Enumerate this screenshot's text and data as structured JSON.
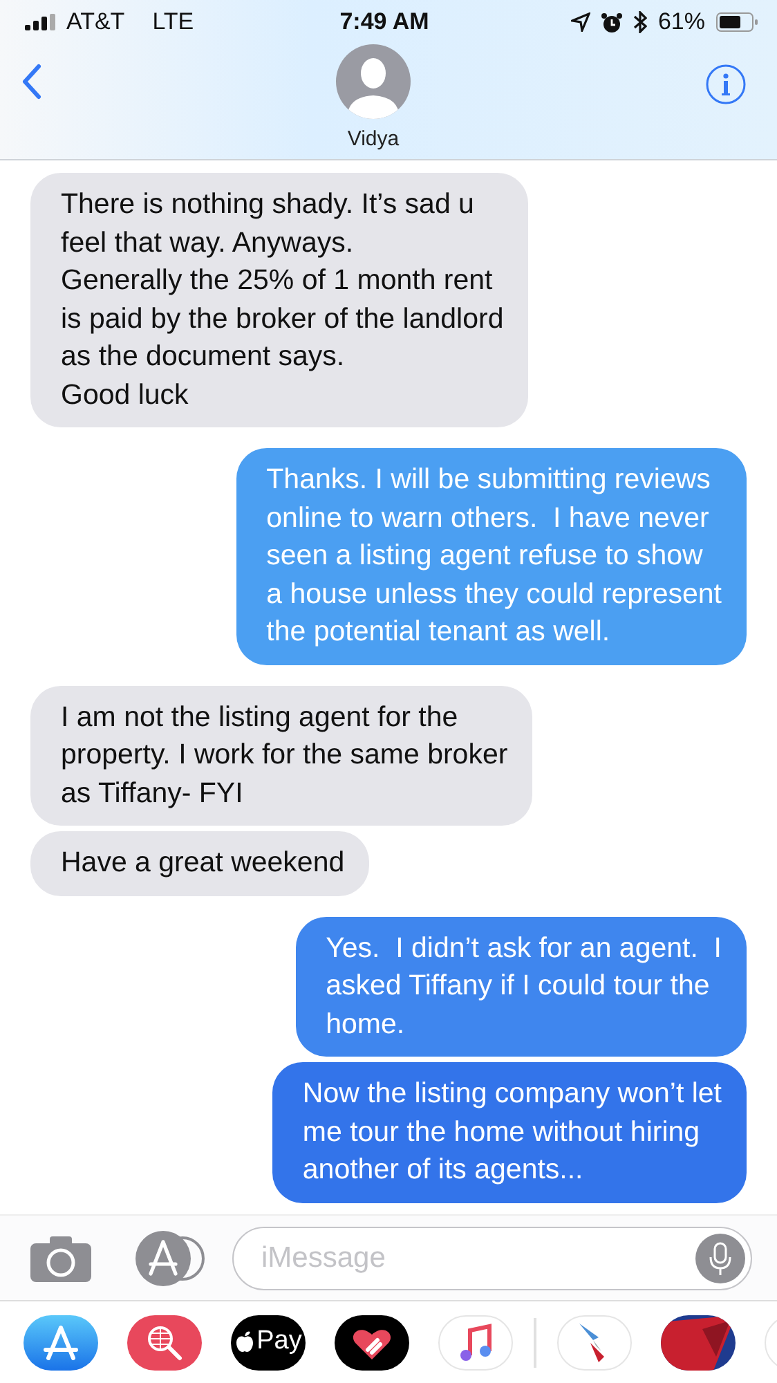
{
  "status_bar": {
    "carrier": "AT&T",
    "network": "LTE",
    "time": "7:49 AM",
    "battery_text": "61%"
  },
  "header": {
    "contact_name": "Vidya"
  },
  "messages": [
    {
      "kind": "incoming",
      "text": "There is nothing shady. It’s sad u\nfeel that way. Anyways.\nGenerally the 25% of 1 month rent\nis paid by the broker of the landlord\nas the document says.\nGood luck"
    },
    {
      "kind": "outgoing",
      "text": "Thanks. I will be submitting reviews\nonline to warn others.  I have never\nseen a listing agent refuse to show\na house unless they could represent\nthe potential tenant as well."
    },
    {
      "kind": "incoming",
      "text": "I am not the listing agent for the\nproperty. I work for the same broker\nas Tiffany- FYI"
    },
    {
      "kind": "incoming",
      "text": "Have a great weekend"
    },
    {
      "kind": "outgoing",
      "text": "Yes.  I didn’t ask for an agent.  I\nasked Tiffany if I could tour the\nhome."
    },
    {
      "kind": "outgoing",
      "text": "Now the listing company won’t let\nme tour the home without hiring\nanother of its agents..."
    }
  ],
  "compose": {
    "placeholder": "iMessage"
  },
  "app_drawer": {
    "pay_label": "Pay"
  }
}
